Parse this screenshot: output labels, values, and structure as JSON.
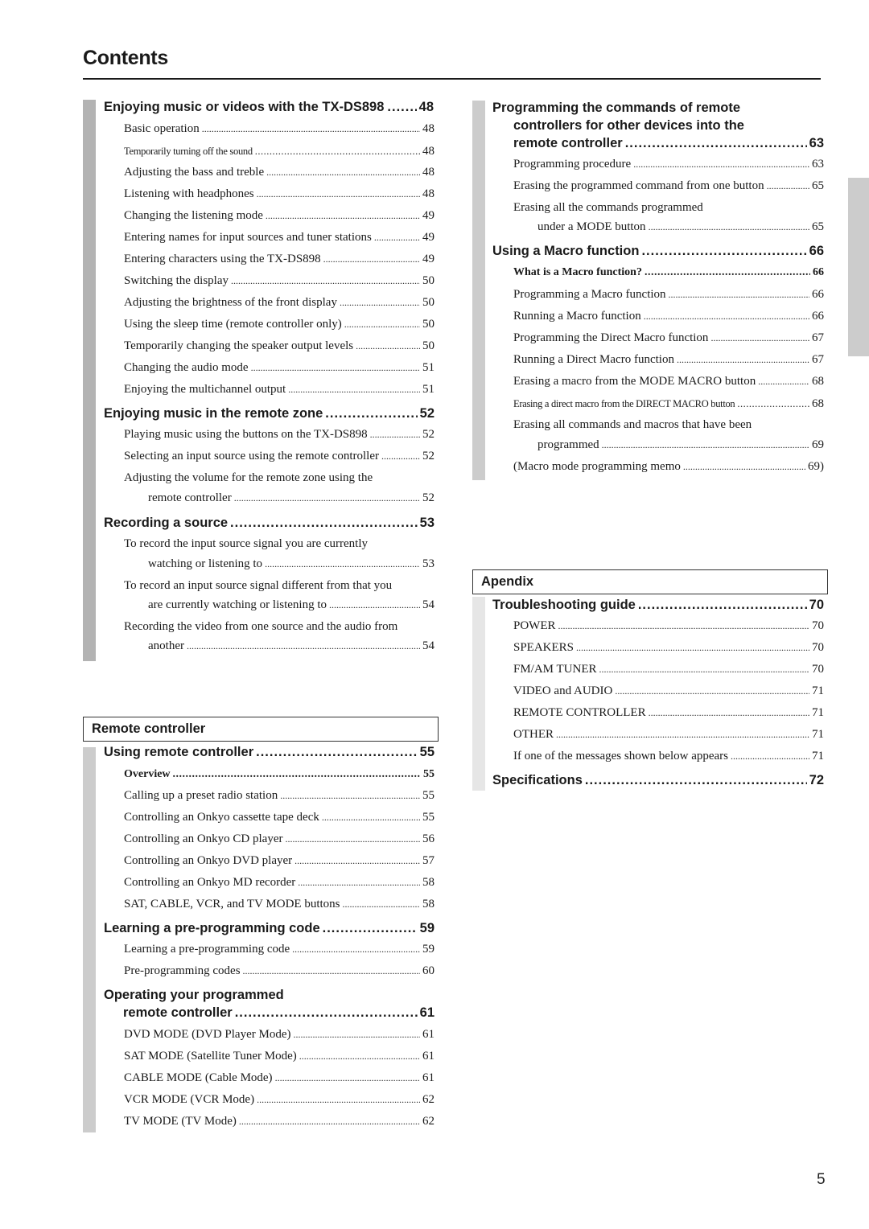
{
  "page": {
    "title": "Contents",
    "page_number": "5"
  },
  "left": {
    "sec1": {
      "heading": {
        "label": "Enjoying music or videos with the TX-DS898",
        "page": "48"
      },
      "items": [
        {
          "label": "Basic operation",
          "page": "48"
        },
        {
          "label": "Temporarily turning off the sound",
          "page": "48"
        },
        {
          "label": "Adjusting the bass and treble",
          "page": "48"
        },
        {
          "label": "Listening with headphones",
          "page": "48"
        },
        {
          "label": "Changing the listening mode",
          "page": "49"
        },
        {
          "label": "Entering names for input sources and tuner stations",
          "page": "49"
        },
        {
          "label": "Entering characters using the TX-DS898",
          "page": "49"
        },
        {
          "label": "Switching the display",
          "page": "50"
        },
        {
          "label": "Adjusting the brightness of the front display",
          "page": "50"
        },
        {
          "label": "Using the sleep time (remote controller only)",
          "page": "50"
        },
        {
          "label": "Temporarily changing the speaker output levels",
          "page": "50"
        },
        {
          "label": "Changing the audio mode",
          "page": "51"
        },
        {
          "label": "Enjoying the multichannel output",
          "page": "51"
        }
      ],
      "heading2": {
        "label": "Enjoying music in the remote zone",
        "page": "52"
      },
      "items2": [
        {
          "label": "Playing music using the buttons on the TX-DS898",
          "page": "52"
        },
        {
          "label": "Selecting an input source using the remote controller",
          "page": "52"
        },
        {
          "line1": "Adjusting the volume for the remote zone using the",
          "label": "remote controller",
          "page": "52"
        }
      ],
      "heading3": {
        "label": "Recording a source",
        "page": "53"
      },
      "items3": [
        {
          "line1": "To record the input source signal you are currently",
          "label": "watching or listening to",
          "page": "53"
        },
        {
          "line1": "To record an input source signal different from that you",
          "label": "are currently watching or listening to",
          "page": "54"
        },
        {
          "line1": "Recording the video from one source and the audio from",
          "label": "another",
          "page": "54"
        }
      ]
    },
    "remote": {
      "box_title": "Remote controller",
      "heading": {
        "label": "Using remote controller",
        "page": "55"
      },
      "items": [
        {
          "label": "Overview",
          "page": "55"
        },
        {
          "label": "Calling up a preset radio station",
          "page": "55"
        },
        {
          "label": "Controlling an Onkyo cassette tape deck",
          "page": "55"
        },
        {
          "label": "Controlling an Onkyo CD player",
          "page": "56"
        },
        {
          "label": "Controlling an Onkyo DVD player",
          "page": "57"
        },
        {
          "label": "Controlling an Onkyo MD recorder",
          "page": "58"
        },
        {
          "label": "SAT, CABLE, VCR, and TV MODE buttons",
          "page": "58"
        }
      ],
      "heading2": {
        "label": "Learning a pre-programming code",
        "page": "59"
      },
      "items2": [
        {
          "label": "Learning a pre-programming code",
          "page": "59"
        },
        {
          "label": "Pre-programming codes",
          "page": "60"
        }
      ],
      "heading3": {
        "line1": "Operating your programmed",
        "label": "remote controller",
        "page": "61"
      },
      "items3": [
        {
          "label": "DVD MODE (DVD Player Mode)",
          "page": "61"
        },
        {
          "label": "SAT MODE (Satellite Tuner Mode)",
          "page": "61"
        },
        {
          "label": "CABLE MODE (Cable Mode)",
          "page": "61"
        },
        {
          "label": "VCR MODE (VCR Mode)",
          "page": "62"
        },
        {
          "label": "TV MODE (TV Mode)",
          "page": "62"
        }
      ]
    }
  },
  "right": {
    "prog": {
      "heading": {
        "line1": "Programming the commands of remote",
        "line2": "controllers for other devices into the",
        "label": "remote controller",
        "page": "63"
      },
      "items": [
        {
          "label": "Programming procedure",
          "page": "63"
        },
        {
          "label": "Erasing the programmed command from one button",
          "page": "65"
        },
        {
          "line1": "Erasing all the commands programmed",
          "label": "under a MODE button",
          "page": "65"
        }
      ],
      "heading2": {
        "label": "Using a Macro function",
        "page": "66"
      },
      "items2": [
        {
          "label": "What is a Macro function?",
          "page": "66"
        },
        {
          "label": "Programming a Macro function",
          "page": "66"
        },
        {
          "label": "Running a Macro function",
          "page": "66"
        },
        {
          "label": "Programming the Direct Macro function",
          "page": "67"
        },
        {
          "label": "Running a Direct Macro function",
          "page": "67"
        },
        {
          "label": "Erasing a macro from the MODE MACRO button",
          "page": "68"
        },
        {
          "label": "Erasing a direct macro from the DIRECT MACRO button",
          "page": "68"
        },
        {
          "line1": "Erasing all commands and macros that have been",
          "label": "programmed",
          "page": "69"
        },
        {
          "label": "(Macro mode programming memo",
          "page": "69)"
        }
      ]
    },
    "appendix": {
      "box_title": "Apendix",
      "heading": {
        "label": "Troubleshooting guide",
        "page": "70"
      },
      "items": [
        {
          "label": "POWER",
          "page": "70"
        },
        {
          "label": "SPEAKERS",
          "page": "70"
        },
        {
          "label": "FM/AM TUNER",
          "page": "70"
        },
        {
          "label": "VIDEO and AUDIO",
          "page": "71"
        },
        {
          "label": "REMOTE CONTROLLER",
          "page": "71"
        },
        {
          "label": "OTHER",
          "page": "71"
        },
        {
          "label": "If one of the messages shown below appears",
          "page": "71"
        }
      ],
      "heading2": {
        "label": "Specifications",
        "page": "72"
      }
    }
  }
}
